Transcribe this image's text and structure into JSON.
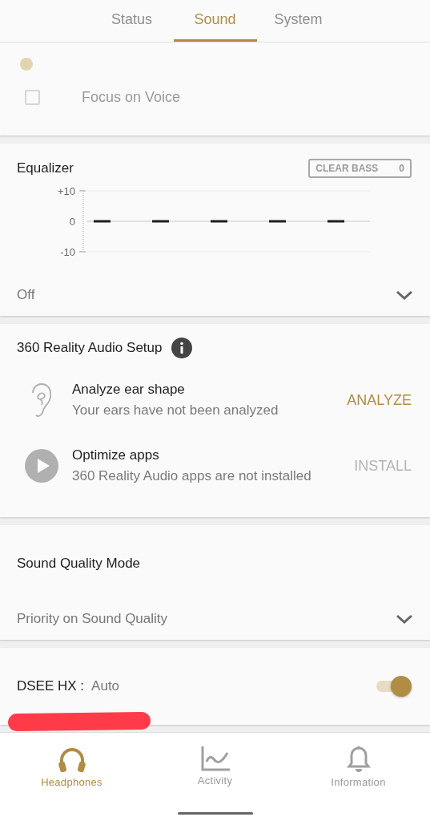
{
  "tabs": [
    {
      "label": "Status",
      "selected": false
    },
    {
      "label": "Sound",
      "selected": true
    },
    {
      "label": "System",
      "selected": false
    }
  ],
  "voice": {
    "label": "Focus on Voice",
    "checked": false,
    "disabled": true
  },
  "equalizer": {
    "title": "Equalizer",
    "clear_bass": {
      "label": "CLEAR BASS",
      "value": "0"
    },
    "scale_labels": [
      "+10",
      "0",
      "-10"
    ],
    "preset": "Off"
  },
  "reality_audio": {
    "title": "360 Reality Audio Setup",
    "items": [
      {
        "kind": "ear",
        "title": "Analyze ear shape",
        "subtitle": "Your ears have not been analyzed",
        "action": "ANALYZE",
        "disabled": false
      },
      {
        "kind": "play",
        "title": "Optimize apps",
        "subtitle": "360 Reality Audio apps are not installed",
        "action": "INSTALL",
        "disabled": true
      }
    ]
  },
  "sound_quality": {
    "title": "Sound Quality Mode",
    "value": "Priority on Sound Quality"
  },
  "dsee": {
    "label": "DSEE HX :",
    "value": "Auto",
    "on": true
  },
  "nav": [
    {
      "kind": "headphones",
      "label": "Headphones",
      "selected": true
    },
    {
      "kind": "activity",
      "label": "Activity",
      "selected": false
    },
    {
      "kind": "bell",
      "label": "Information",
      "selected": false
    }
  ]
}
